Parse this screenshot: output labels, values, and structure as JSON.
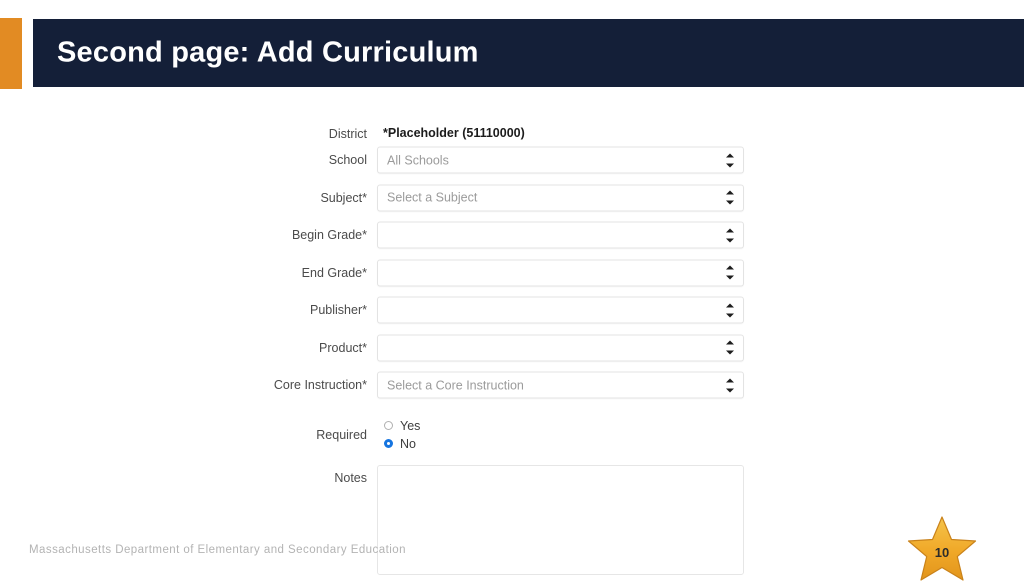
{
  "slide": {
    "title": "Second page: Add Curriculum",
    "accent_color": "#e28b23",
    "header_color": "#141f38",
    "footer": "Massachusetts Department of Elementary and Secondary Education",
    "number": "10"
  },
  "form": {
    "rows": [
      {
        "label": "District",
        "type": "static",
        "value": "*Placeholder (51110000)"
      },
      {
        "label": "School",
        "type": "select",
        "value": "All Schools"
      },
      {
        "label": "Subject*",
        "type": "select",
        "value": "Select a Subject"
      },
      {
        "label": "Begin Grade*",
        "type": "select",
        "value": ""
      },
      {
        "label": "End Grade*",
        "type": "select",
        "value": ""
      },
      {
        "label": "Publisher*",
        "type": "select",
        "value": ""
      },
      {
        "label": "Product*",
        "type": "select",
        "value": ""
      },
      {
        "label": "Core Instruction*",
        "type": "select",
        "value": "Select a Core Instruction"
      },
      {
        "label": "Required",
        "type": "radio"
      },
      {
        "label": "Notes",
        "type": "textarea",
        "value": ""
      }
    ],
    "required_radio": {
      "options": [
        {
          "label": "Yes",
          "selected": false
        },
        {
          "label": "No",
          "selected": true
        }
      ],
      "selected_color": "#1675e0"
    }
  }
}
